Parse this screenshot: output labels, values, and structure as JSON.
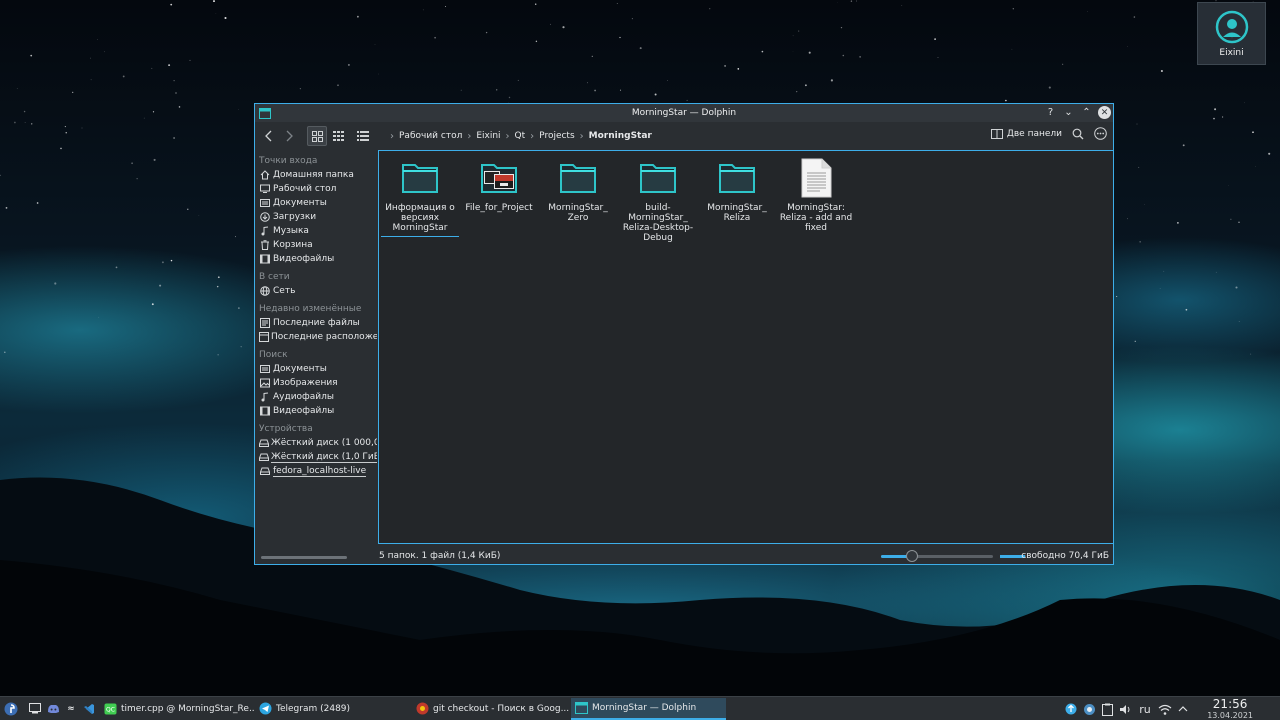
{
  "desktop": {
    "user_widget_label": "Eixini"
  },
  "window": {
    "title": "MorningStar — Dolphin",
    "controls": {
      "help": "?",
      "minimize": "⌄",
      "maximize": "⌃",
      "close": "✕"
    }
  },
  "toolbar": {
    "breadcrumb": [
      "Рабочий стол",
      "Eixini",
      "Qt",
      "Projects",
      "MorningStar"
    ],
    "split_label": "Две панели"
  },
  "sidebar": {
    "sections": [
      {
        "title": "Точки входа",
        "items": [
          {
            "label": "Домашняя папка",
            "icon": "home-icon"
          },
          {
            "label": "Рабочий стол",
            "icon": "desktop-icon"
          },
          {
            "label": "Документы",
            "icon": "documents-icon"
          },
          {
            "label": "Загрузки",
            "icon": "downloads-icon"
          },
          {
            "label": "Музыка",
            "icon": "music-icon"
          },
          {
            "label": "Корзина",
            "icon": "trash-icon"
          },
          {
            "label": "Видеофайлы",
            "icon": "video-icon"
          }
        ]
      },
      {
        "title": "В сети",
        "items": [
          {
            "label": "Сеть",
            "icon": "network-icon"
          }
        ]
      },
      {
        "title": "Недавно изменённые",
        "items": [
          {
            "label": "Последние файлы",
            "icon": "recent-files-icon"
          },
          {
            "label": "Последние расположе",
            "icon": "recent-locations-icon"
          }
        ]
      },
      {
        "title": "Поиск",
        "items": [
          {
            "label": "Документы",
            "icon": "documents-icon"
          },
          {
            "label": "Изображения",
            "icon": "images-icon"
          },
          {
            "label": "Аудиофайлы",
            "icon": "audio-icon"
          },
          {
            "label": "Видеофайлы",
            "icon": "video-icon"
          }
        ]
      },
      {
        "title": "Устройства",
        "items": [
          {
            "label": "Жёсткий диск (1 000,0",
            "icon": "drive-icon"
          },
          {
            "label": "Жёсткий диск (1,0 ГиБ",
            "icon": "drive-icon"
          },
          {
            "label": "fedora_localhost-live",
            "icon": "drive-icon"
          }
        ]
      }
    ]
  },
  "files": [
    {
      "name": "Информация о версиях MorningStar",
      "type": "folder"
    },
    {
      "name": "File_for_Project",
      "type": "folder-preview"
    },
    {
      "name": "MorningStar_ Zero",
      "type": "folder"
    },
    {
      "name": "build-MorningStar_ Reliza-Desktop-Debug",
      "type": "folder"
    },
    {
      "name": "MorningStar_ Reliza",
      "type": "folder"
    },
    {
      "name": "MorningStar: Reliza - add and fixed",
      "type": "text-file"
    }
  ],
  "statusbar": {
    "summary": "5 папок. 1 файл (1,4 КиБ)",
    "free_space": "свободно 70,4 ГиБ",
    "zoom_level": 0.28,
    "disk_used_fraction": 0.95
  },
  "taskbar": {
    "tasks": [
      {
        "label": "timer.cpp @ MorningStar_Re...",
        "icon": "qtcreator-icon"
      },
      {
        "label": "Telegram (2489)",
        "icon": "telegram-icon"
      },
      {
        "label": "git checkout - Поиск в Goog...",
        "icon": "browser-icon"
      },
      {
        "label": "MorningStar — Dolphin",
        "icon": "dolphin-icon"
      }
    ],
    "keyboard_layout": "ru",
    "time": "21:56",
    "date": "13.04.2021"
  },
  "colors": {
    "accent": "#3daee9",
    "folder": "#2ec5c9",
    "window_bg": "#2a2e32",
    "content_bg": "#232629"
  }
}
